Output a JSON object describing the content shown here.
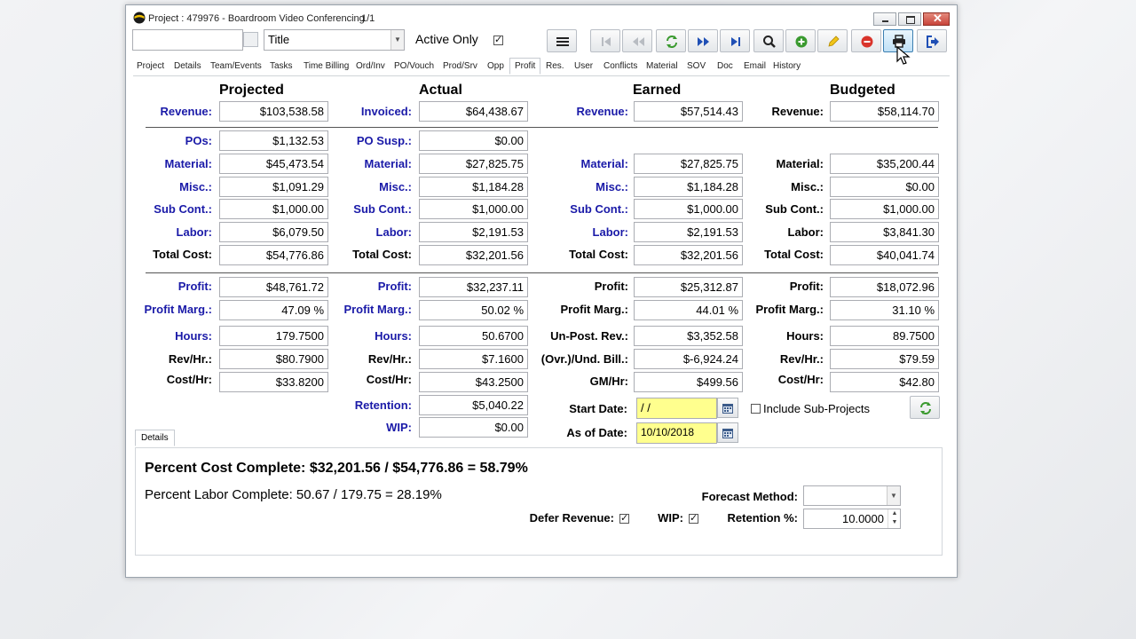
{
  "window": {
    "title": "Project : 479976 - Boardroom Video Conferencing",
    "record_count": "1/1"
  },
  "toolbar": {
    "title_combo": "Title",
    "active_only": "Active Only",
    "active_only_checked": true
  },
  "tabs": [
    "Project",
    "Details",
    "Team/Events",
    "Tasks",
    "Time Billing",
    "Ord/Inv",
    "PO/Vouch",
    "Prod/Srv",
    "Opp",
    "Profit",
    "Res.",
    "User",
    "Conflicts",
    "Material",
    "SOV",
    "Doc",
    "Email",
    "History"
  ],
  "active_tab": "Profit",
  "headers": {
    "projected": "Projected",
    "actual": "Actual",
    "earned": "Earned",
    "budgeted": "Budgeted"
  },
  "projected": {
    "revenue_label": "Revenue:",
    "revenue": "$103,538.58",
    "pos_label": "POs:",
    "pos": "$1,132.53",
    "material_label": "Material:",
    "material": "$45,473.54",
    "misc_label": "Misc.:",
    "misc": "$1,091.29",
    "subcont_label": "Sub Cont.:",
    "subcont": "$1,000.00",
    "labor_label": "Labor:",
    "labor": "$6,079.50",
    "totalcost_label": "Total Cost:",
    "totalcost": "$54,776.86",
    "profit_label": "Profit:",
    "profit": "$48,761.72",
    "margin_label": "Profit Marg.:",
    "margin": "47.09 %",
    "hours_label": "Hours:",
    "hours": "179.7500",
    "revhr_label": "Rev/Hr.:",
    "revhr": "$80.7900",
    "costhr_label": "Cost/Hr:",
    "costhr": "$33.8200"
  },
  "actual": {
    "invoiced_label": "Invoiced:",
    "invoiced": "$64,438.67",
    "posusp_label": "PO Susp.:",
    "posusp": "$0.00",
    "material_label": "Material:",
    "material": "$27,825.75",
    "misc_label": "Misc.:",
    "misc": "$1,184.28",
    "subcont_label": "Sub Cont.:",
    "subcont": "$1,000.00",
    "labor_label": "Labor:",
    "labor": "$2,191.53",
    "totalcost_label": "Total Cost:",
    "totalcost": "$32,201.56",
    "profit_label": "Profit:",
    "profit": "$32,237.11",
    "margin_label": "Profit Marg.:",
    "margin": "50.02 %",
    "hours_label": "Hours:",
    "hours": "50.6700",
    "revhr_label": "Rev/Hr.:",
    "revhr": "$7.1600",
    "costhr_label": "Cost/Hr:",
    "costhr": "$43.2500",
    "retention_label": "Retention:",
    "retention": "$5,040.22",
    "wip_label": "WIP:",
    "wip": "$0.00"
  },
  "earned": {
    "revenue_label": "Revenue:",
    "revenue": "$57,514.43",
    "material_label": "Material:",
    "material": "$27,825.75",
    "misc_label": "Misc.:",
    "misc": "$1,184.28",
    "subcont_label": "Sub Cont.:",
    "subcont": "$1,000.00",
    "labor_label": "Labor:",
    "labor": "$2,191.53",
    "totalcost_label": "Total Cost:",
    "totalcost": "$32,201.56",
    "profit_label": "Profit:",
    "profit": "$25,312.87",
    "margin_label": "Profit Marg.:",
    "margin": "44.01 %",
    "unpost_label": "Un-Post. Rev.:",
    "unpost": "$3,352.58",
    "ovrund_label": "(Ovr.)/Und. Bill.:",
    "ovrund": "$-6,924.24",
    "gmhr_label": "GM/Hr:",
    "gmhr": "$499.56",
    "startdate_label": "Start Date:",
    "startdate": " /  /",
    "asof_label": "As of Date:",
    "asof": "10/10/2018"
  },
  "budgeted": {
    "revenue_label": "Revenue:",
    "revenue": "$58,114.70",
    "material_label": "Material:",
    "material": "$35,200.44",
    "misc_label": "Misc.:",
    "misc": "$0.00",
    "subcont_label": "Sub Cont.:",
    "subcont": "$1,000.00",
    "labor_label": "Labor:",
    "labor": "$3,841.30",
    "totalcost_label": "Total Cost:",
    "totalcost": "$40,041.74",
    "profit_label": "Profit:",
    "profit": "$18,072.96",
    "margin_label": "Profit Marg.:",
    "margin": "31.10 %",
    "hours_label": "Hours:",
    "hours": "89.7500",
    "revhr_label": "Rev/Hr.:",
    "revhr": "$79.59",
    "costhr_label": "Cost/Hr:",
    "costhr": "$42.80",
    "include_sub": "Include Sub-Projects",
    "include_sub_checked": false
  },
  "details": {
    "tab_label": "Details",
    "percent_cost": "Percent Cost Complete: $32,201.56 / $54,776.86 = 58.79%",
    "percent_labor": "Percent Labor Complete: 50.67 / 179.75 = 28.19%",
    "forecast_label": "Forecast Method:",
    "forecast_value": "",
    "defer_label": "Defer Revenue:",
    "defer_checked": true,
    "wip_label": "WIP:",
    "wip_checked": true,
    "retention_label": "Retention %:",
    "retention_value": "10.0000"
  },
  "icons": [
    "menu-icon",
    "first-record-icon",
    "prev-record-icon",
    "refresh-icon",
    "next-record-icon",
    "last-record-icon",
    "search-icon",
    "add-icon",
    "edit-icon",
    "delete-icon",
    "print-icon",
    "exit-icon",
    "calendar-icon",
    "mouse-cursor-icon"
  ],
  "colors": {
    "label_blue": "#1a1aa8",
    "date_yellow": "#ffff8e",
    "refresh_green": "#3a9a2f",
    "delete_red": "#d9342b",
    "nav_blue": "#1f4fb5"
  }
}
